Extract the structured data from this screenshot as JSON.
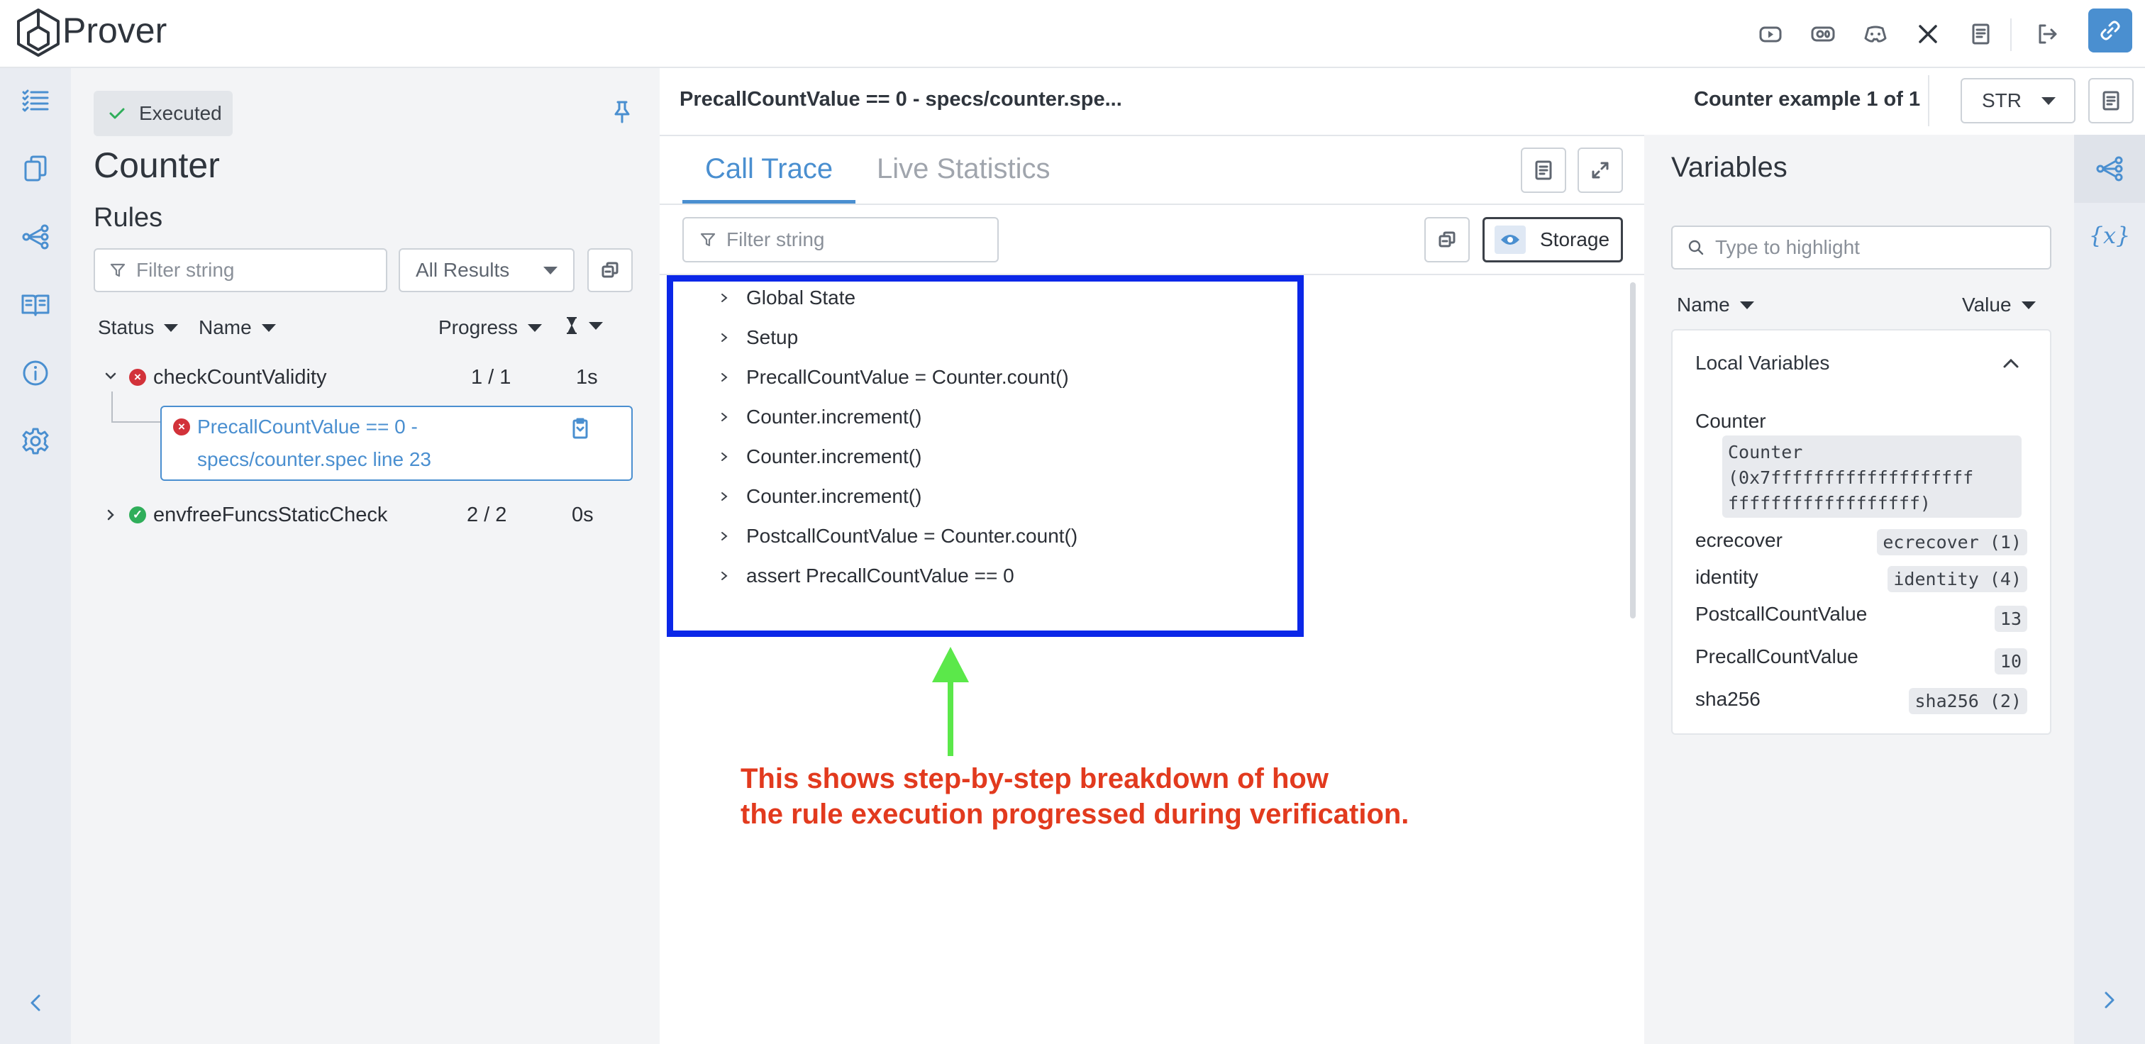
{
  "header": {
    "brand": "Prover",
    "icons": [
      "youtube-icon",
      "medium-icon",
      "discord-icon",
      "x-icon",
      "book-icon",
      "logout-icon"
    ],
    "link_icon": "link-icon",
    "accent": "#4a8fd0"
  },
  "rail": {
    "items": [
      "list-icon",
      "files-icon",
      "graph-icon",
      "docs-icon",
      "info-icon",
      "settings-icon"
    ],
    "collapse_icon": "chevron-left-icon"
  },
  "left_panel": {
    "status_badge": "Executed",
    "title": "Counter",
    "rules_heading": "Rules",
    "filter_placeholder": "Filter string",
    "results_select": "All Results",
    "columns": {
      "status": "Status",
      "name": "Name",
      "progress": "Progress",
      "time_icon": "hourglass-icon"
    },
    "rules": [
      {
        "name": "checkCountValidity",
        "status": "failed",
        "progress": "1 / 1",
        "time": "1s",
        "expanded": true,
        "children": [
          {
            "text_line1": "PrecallCountValue == 0 -",
            "text_line2": "specs/counter.spec line 23",
            "status": "failed"
          }
        ]
      },
      {
        "name": "envfreeFuncsStaticCheck",
        "status": "passed",
        "progress": "2 / 2",
        "time": "0s",
        "expanded": false
      }
    ],
    "colors": {
      "failed": "#d2323a",
      "passed": "#2fae5a"
    }
  },
  "center": {
    "title": "PrecallCountValue == 0 - specs/counter.spe...",
    "example_label": "Counter example 1 of 1",
    "str_select": "STR",
    "tabs": [
      "Call Trace",
      "Live Statistics"
    ],
    "active_tab": "Call Trace",
    "filter_placeholder": "Filter string",
    "storage_button": "Storage",
    "trace_items": [
      "Global State",
      "Setup",
      "PrecallCountValue = Counter.count()",
      "Counter.increment()",
      "Counter.increment()",
      "Counter.increment()",
      "PostcallCountValue = Counter.count()",
      "assert PrecallCountValue == 0"
    ],
    "annotation": {
      "line1": "This shows step-by-step breakdown of how",
      "line2": "the rule execution progressed during verification.",
      "box_color": "#0b27e8",
      "arrow_color": "#5be84a",
      "text_color": "#e23a1e"
    }
  },
  "variables": {
    "title": "Variables",
    "search_placeholder": "Type to highlight",
    "columns": {
      "name": "Name",
      "value": "Value"
    },
    "section": "Local Variables",
    "items": [
      {
        "name": "Counter",
        "value": "Counter\n(0x7fffffffffffffffffff\nffffffffffffffffff)"
      },
      {
        "name": "ecrecover",
        "value": "ecrecover (1)"
      },
      {
        "name": "identity",
        "value": "identity (4)"
      },
      {
        "name": "PostcallCountValue",
        "value": "13"
      },
      {
        "name": "PrecallCountValue",
        "value": "10"
      },
      {
        "name": "sha256",
        "value": "sha256 (2)"
      }
    ]
  },
  "right_rail": {
    "items": [
      "graph-icon",
      "variable-icon"
    ],
    "variable_glyph": "{x}",
    "expand_icon": "chevron-right-icon"
  }
}
